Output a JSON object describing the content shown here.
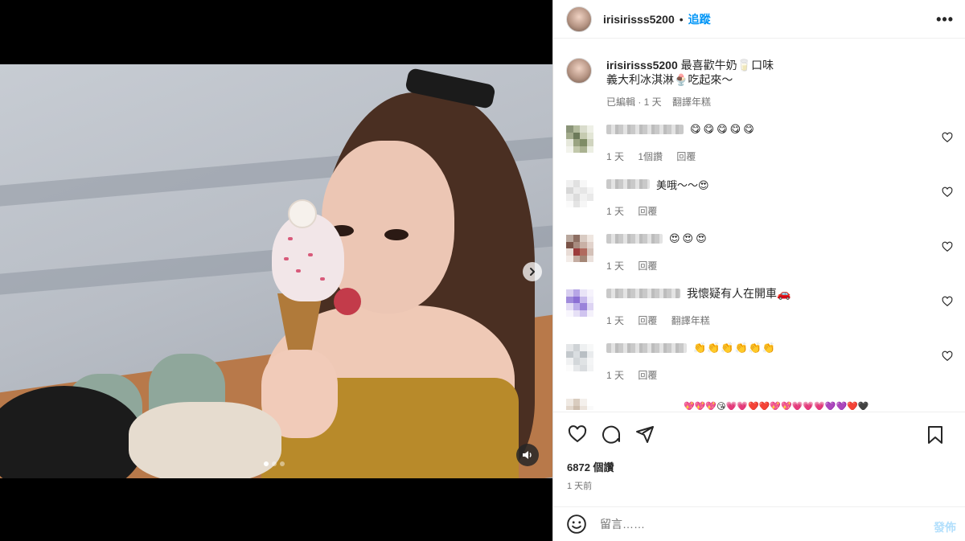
{
  "post": {
    "username": "irisirisss5200",
    "separator": "•",
    "follow_label": "追蹤",
    "more_label": "•••",
    "media": {
      "carousel_slide_count": 3,
      "active_slide": 1
    }
  },
  "caption": {
    "username": "irisirisss5200",
    "line1": "最喜歡牛奶🥛口味",
    "line2": "義大利冰淇淋🍨吃起來～",
    "edited": "已編輯 · 1 天",
    "translate": "翻譯年糕"
  },
  "comments": [
    {
      "text": "😋😋😋😋😋",
      "time": "1 天",
      "likes": "1個讚",
      "reply": "回覆"
    },
    {
      "text": "美哦～～😍",
      "time": "1 天",
      "reply": "回覆"
    },
    {
      "text": "😍😍😍",
      "time": "1 天",
      "reply": "回覆"
    },
    {
      "text": "我懷疑有人在開車🚗",
      "time": "1 天",
      "reply": "回覆",
      "translate": "翻譯年糕"
    },
    {
      "text": "👏👏👏👏👏👏",
      "time": "1 天",
      "reply": "回覆"
    },
    {
      "text": "💖💖💖😘💗💗❤️❤️💖💖💗💗💗💜💜❤️🖤"
    }
  ],
  "stats": {
    "likes": "6872 個讚",
    "posted": "1 天前"
  },
  "composer": {
    "placeholder": "留言……",
    "post_label": "發佈"
  },
  "colors": {
    "accent": "#0095f6",
    "muted": "#737373",
    "border": "#dbdbdb"
  },
  "icons": [
    "chevron-right-icon",
    "volume-icon",
    "heart-icon",
    "comment-icon",
    "share-icon",
    "bookmark-icon",
    "emoji-icon"
  ]
}
